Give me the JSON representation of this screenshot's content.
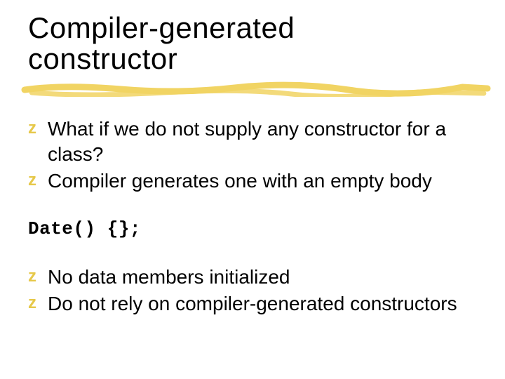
{
  "title_line1": "Compiler-generated",
  "title_line2": "constructor",
  "bullet_glyph": "z",
  "group1": {
    "b1": "What if we do not supply any constructor for a class?",
    "b2": "Compiler generates one with an empty body"
  },
  "code": "Date() {};",
  "group2": {
    "b1": "No data members initialized",
    "b2": "Do not rely on compiler-generated constructors"
  }
}
